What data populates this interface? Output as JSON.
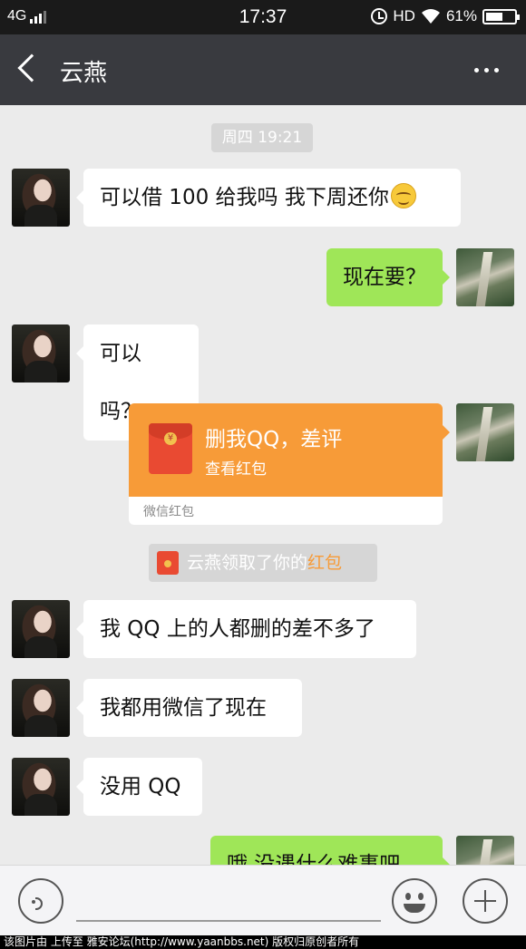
{
  "status_bar": {
    "network": "4G",
    "time": "17:37",
    "hd": "HD",
    "battery": "61%",
    "battery_level": 0.61,
    "icons": [
      "signal-icon",
      "alarm-icon",
      "wifi-icon",
      "battery-icon"
    ]
  },
  "header": {
    "title": "云燕",
    "back_icon": "back-icon",
    "more_icon": "more-icon"
  },
  "chat": {
    "timestamp": "周四 19:21",
    "messages": [
      {
        "side": "left",
        "text": "可以借 100 给我吗 我下周还你",
        "emoji": "smile-emoji"
      },
      {
        "side": "right",
        "text": "现在要？"
      },
      {
        "side": "left",
        "text": "可以吗？"
      },
      {
        "side": "left",
        "text": "我 QQ 上的人都删的差不多了"
      },
      {
        "side": "left",
        "text": "我都用微信了现在"
      },
      {
        "side": "left",
        "text": "没用 QQ"
      },
      {
        "side": "right",
        "text": "哦 没遇什么难事吧"
      }
    ],
    "red_packet": {
      "title": "删我QQ，差评",
      "subtitle": "查看红包",
      "footer": "微信红包",
      "color": "#f79b38"
    },
    "system_notice": {
      "text": "云燕领取了你的",
      "link": "红包",
      "link_color": "#f79b38"
    }
  },
  "input_bar": {
    "voice_icon": "voice-icon",
    "emoji_icon": "emoji-icon",
    "plus_icon": "plus-icon"
  },
  "watermark": "该图片由 上传至 雅安论坛(http://www.yaanbbs.net) 版权归原创者所有",
  "colors": {
    "header_bg": "#393a3f",
    "chat_bg": "#ebebeb",
    "sent_bubble": "#9fe658",
    "received_bubble": "#ffffff"
  }
}
